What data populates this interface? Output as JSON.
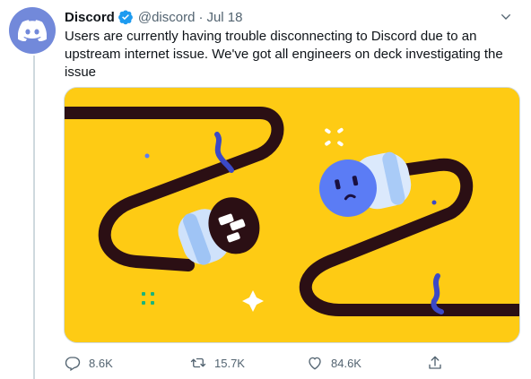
{
  "tweet": {
    "author_name": "Discord",
    "handle": "@discord",
    "separator": "·",
    "date": "Jul 18",
    "text": "Users are currently having trouble disconnecting to Discord due to an upstream internet issue. We've got all engineers on deck investigating the issue",
    "verified": true
  },
  "actions": {
    "replies": "8.6K",
    "retweets": "15.7K",
    "likes": "84.6K"
  },
  "colors": {
    "discord_blurple": "#7289da",
    "illustration_yellow": "#fecb14",
    "cable": "#2b0f14",
    "plug_face": "#5b7cf5",
    "verified": "#1d9bf0"
  },
  "icons": {
    "reply": "reply-icon",
    "retweet": "retweet-icon",
    "like": "heart-icon",
    "share": "share-icon",
    "more": "chevron-down-icon",
    "verified": "verified-badge-icon"
  }
}
